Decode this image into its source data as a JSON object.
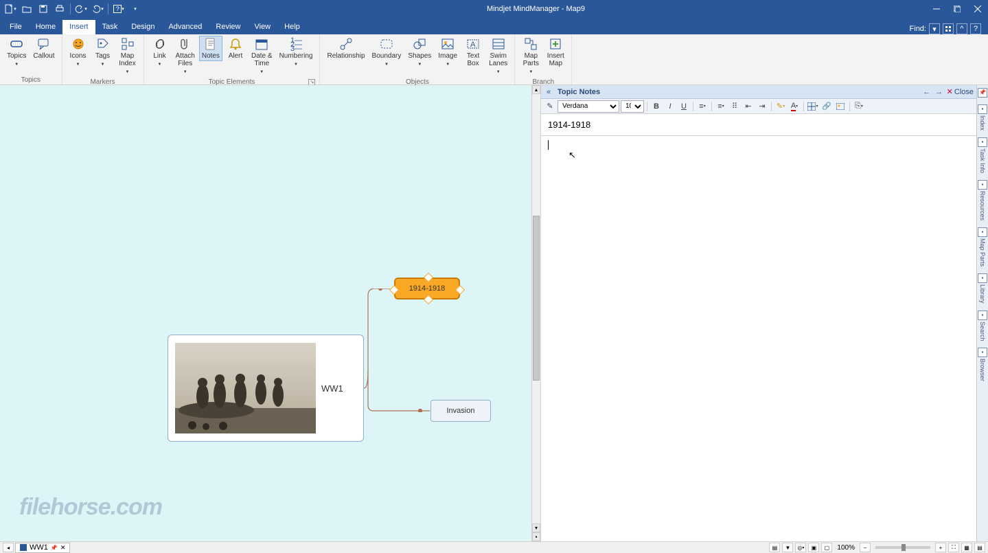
{
  "app_title": "Mindjet MindManager - Map9",
  "menu": {
    "file": "File",
    "tabs": [
      "Home",
      "Insert",
      "Task",
      "Design",
      "Advanced",
      "Review",
      "View",
      "Help"
    ],
    "active": 1
  },
  "find_label": "Find:",
  "ribbon": {
    "groups": [
      {
        "label": "Topics",
        "items": [
          {
            "label": "Topics",
            "drop": true
          },
          {
            "label": "Callout"
          }
        ]
      },
      {
        "label": "Markers",
        "items": [
          {
            "label": "Icons",
            "drop": true
          },
          {
            "label": "Tags",
            "drop": true
          },
          {
            "label": "Map\nIndex",
            "drop": true
          }
        ]
      },
      {
        "label": "Topic Elements",
        "launcher": true,
        "items": [
          {
            "label": "Link",
            "drop": true
          },
          {
            "label": "Attach\nFiles",
            "drop": true
          },
          {
            "label": "Notes",
            "active": true
          },
          {
            "label": "Alert"
          },
          {
            "label": "Date &\nTime",
            "drop": true
          },
          {
            "label": "Numbering",
            "drop": true
          }
        ]
      },
      {
        "label": "Objects",
        "items": [
          {
            "label": "Relationship"
          },
          {
            "label": "Boundary",
            "drop": true
          },
          {
            "label": "Shapes",
            "drop": true
          },
          {
            "label": "Image",
            "drop": true
          },
          {
            "label": "Text\nBox"
          },
          {
            "label": "Swim\nLanes",
            "drop": true
          }
        ]
      },
      {
        "label": "Branch",
        "items": [
          {
            "label": "Map\nParts",
            "drop": true
          },
          {
            "label": "Insert\nMap"
          }
        ]
      }
    ]
  },
  "canvas": {
    "central_label": "WW1",
    "topic1": "1914-1918",
    "topic2": "Invasion"
  },
  "notes": {
    "header": "Topic Notes",
    "close": "Close",
    "font": "Verdana",
    "size": "10",
    "title": "1914-1918"
  },
  "rail": [
    "Index",
    "Task Info",
    "Resources",
    "Map Parts",
    "Library",
    "Search",
    "Browser"
  ],
  "status": {
    "tab": "WW1",
    "zoom": "100%"
  },
  "watermark": "filehorse.com"
}
